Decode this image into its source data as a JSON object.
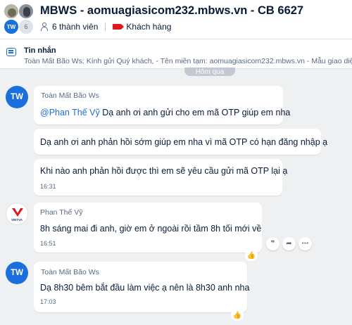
{
  "header": {
    "title": "MBWS - aomuagiasicom232.mbws.vn - CB 6627",
    "avatar_initials": "TW",
    "avatar_count": "6",
    "members": "6 thành viên",
    "tag_label": "Khách hàng",
    "tag_color": "#d91b1b",
    "accent": "#1b6fdc"
  },
  "pinned": {
    "title": "Tin nhắn",
    "text": "Toàn Mất Bão Ws: Kính gửi Quý khách, - Tên miền tạm: aomuagiasicom232.mbws.vn - Mẫu giao diện"
  },
  "time_divider": "Hôm qua",
  "messages": [
    {
      "avatar": "TW",
      "sender": "Toàn Mất Bão Ws",
      "mention": "@Phan Thế Vỹ",
      "text1": " Dạ anh ơi anh gửi cho em mã OTP giúp em nha",
      "text2": "Dạ anh ơi anh phản hồi sớm giúp em nha vì mã OTP có hạn đăng nhập ạ",
      "text3": "Khi nào anh phản hồi được thì em sẽ yêu cầu gửi mã OTP lại ạ",
      "time": "16:31"
    },
    {
      "avatar_text": "VIETVA",
      "sender": "Phan Thế Vỹ",
      "text": "8h sáng mai đi anh, giờ em ở ngoài rồi tầm 8h tối mới về",
      "time": "16:51"
    },
    {
      "avatar": "TW",
      "sender": "Toàn Mất Bão Ws",
      "text": "Dạ 8h30 bêm bắt đầu làm việc ạ nên là 8h30 anh nha",
      "time": "17:03"
    }
  ],
  "actions": {
    "quote_icon": "quote-icon",
    "forward_icon": "forward-icon",
    "more_icon": "more-icon",
    "like_icon": "thumbs-up-icon"
  }
}
